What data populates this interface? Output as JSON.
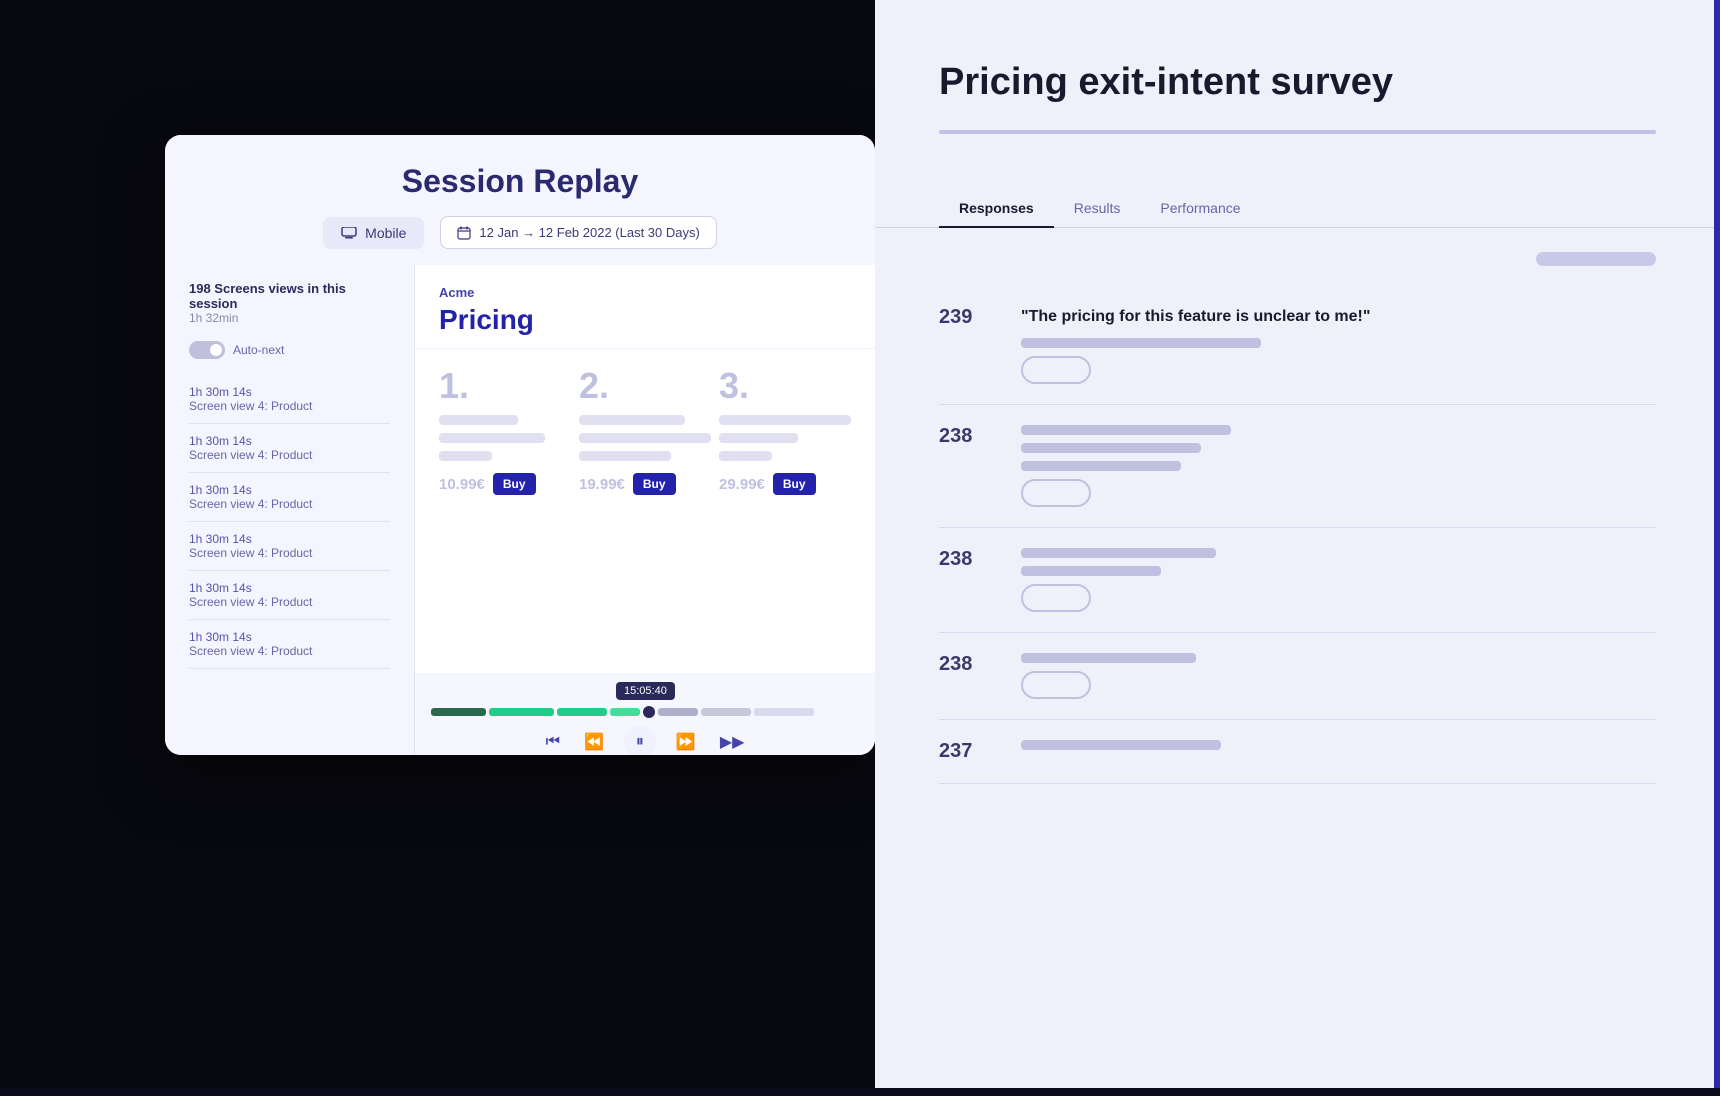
{
  "left_bg": {
    "color": "#08080f"
  },
  "right_bg": {
    "color": "#f0f0fa"
  },
  "session_window": {
    "title": "Session Replay",
    "device_label": "Mobile",
    "date_range": "12 Jan → 12 Feb 2022 (Last 30 Days)",
    "sidebar": {
      "screens_info": "198 Screens views in this session",
      "duration": "1h 32min",
      "auto_next_label": "Auto-next",
      "items": [
        {
          "time": "1h 30m 14s",
          "label": "Screen view 4: Product"
        },
        {
          "time": "1h 30m 14s",
          "label": "Screen view 4: Product"
        },
        {
          "time": "1h 30m 14s",
          "label": "Screen view 4: Product"
        },
        {
          "time": "1h 30m 14s",
          "label": "Screen view 4: Product"
        },
        {
          "time": "1h 30m 14s",
          "label": "Screen view 4: Product"
        },
        {
          "time": "1h 30m 14s",
          "label": "Screen view 4: Product"
        }
      ]
    },
    "replay": {
      "brand": "Acme",
      "page_title": "Pricing",
      "plans": [
        {
          "number": "1.",
          "price": "10.99€",
          "buy_label": "Buy"
        },
        {
          "number": "2.",
          "price": "19.99€",
          "buy_label": "Buy"
        },
        {
          "number": "3.",
          "price": "29.99€",
          "buy_label": "Buy"
        }
      ],
      "time_code": "15:05:40"
    }
  },
  "right_panel": {
    "title": "Pricing exit-intent survey",
    "tabs": [
      {
        "label": "Responses",
        "active": true
      },
      {
        "label": "Results",
        "active": false
      },
      {
        "label": "Performance",
        "active": false
      }
    ],
    "responses": [
      {
        "number": "239",
        "quote": "\"The pricing for this feature is unclear to me!\""
      },
      {
        "number": "238",
        "quote": ""
      },
      {
        "number": "238",
        "quote": ""
      },
      {
        "number": "238",
        "quote": ""
      },
      {
        "number": "237",
        "quote": ""
      }
    ]
  }
}
